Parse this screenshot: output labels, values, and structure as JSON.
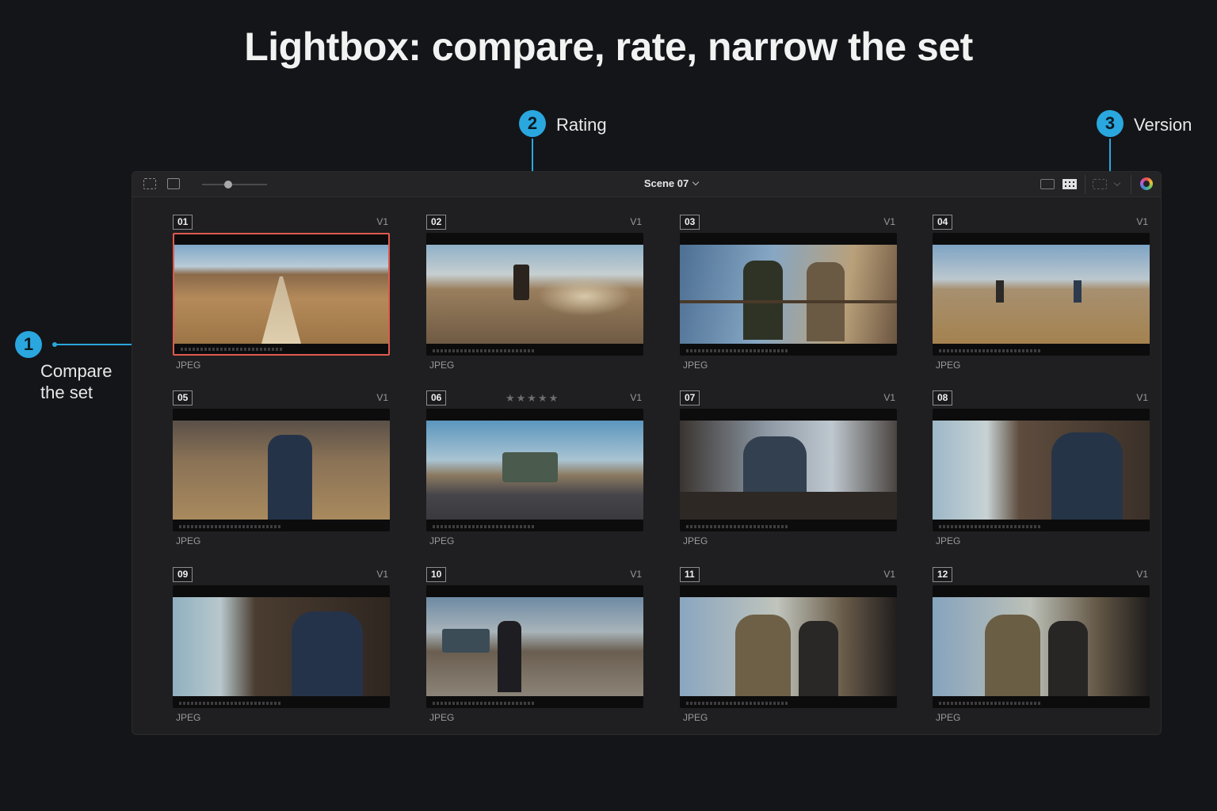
{
  "title": "Lightbox: compare, rate, narrow the set",
  "callouts": [
    {
      "number": "1",
      "label_line1": "Compare",
      "label_line2": "the set"
    },
    {
      "number": "2",
      "label": "Rating"
    },
    {
      "number": "3",
      "label": "Version"
    }
  ],
  "toolbar": {
    "scene_label": "Scene 07"
  },
  "clips": [
    {
      "num": "01",
      "version": "V1",
      "format": "JPEG"
    },
    {
      "num": "02",
      "version": "V1",
      "format": "JPEG"
    },
    {
      "num": "03",
      "version": "V1",
      "format": "JPEG"
    },
    {
      "num": "04",
      "version": "V1",
      "format": "JPEG"
    },
    {
      "num": "05",
      "version": "V1",
      "format": "JPEG"
    },
    {
      "num": "06",
      "version": "V1",
      "format": "JPEG",
      "rating_stars": "★★★★★"
    },
    {
      "num": "07",
      "version": "V1",
      "format": "JPEG"
    },
    {
      "num": "08",
      "version": "V1",
      "format": "JPEG"
    },
    {
      "num": "09",
      "version": "V1",
      "format": "JPEG"
    },
    {
      "num": "10",
      "version": "V1",
      "format": "JPEG"
    },
    {
      "num": "11",
      "version": "V1",
      "format": "JPEG"
    },
    {
      "num": "12",
      "version": "V1",
      "format": "JPEG"
    }
  ],
  "colors": {
    "accent": "#2aa7de",
    "selection": "#e05a4e"
  }
}
